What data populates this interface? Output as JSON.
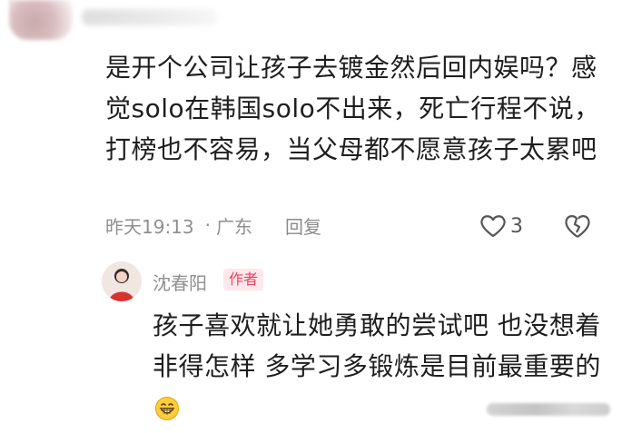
{
  "comment": {
    "text": "是开个公司让孩子去镀金然后回内娱吗？感觉solo在韩国solo不出来，死亡行程不说，打榜也不容易，当父母都不愿意孩子太累吧",
    "time": "昨天19:13",
    "separator": "·",
    "location": "广东",
    "reply_label": "回复",
    "like_count": "3",
    "icons": {
      "like": "heart-outline-icon",
      "dislike": "broken-heart-icon"
    }
  },
  "reply": {
    "author_name": "沈春阳",
    "author_badge": "作者",
    "text": "孩子喜欢就让她勇敢的尝试吧 也没想着非得怎样 多学习多锻炼是目前最重要的",
    "emoji_icon": "grinning-face-icon",
    "badge_color": "#f0425f"
  }
}
